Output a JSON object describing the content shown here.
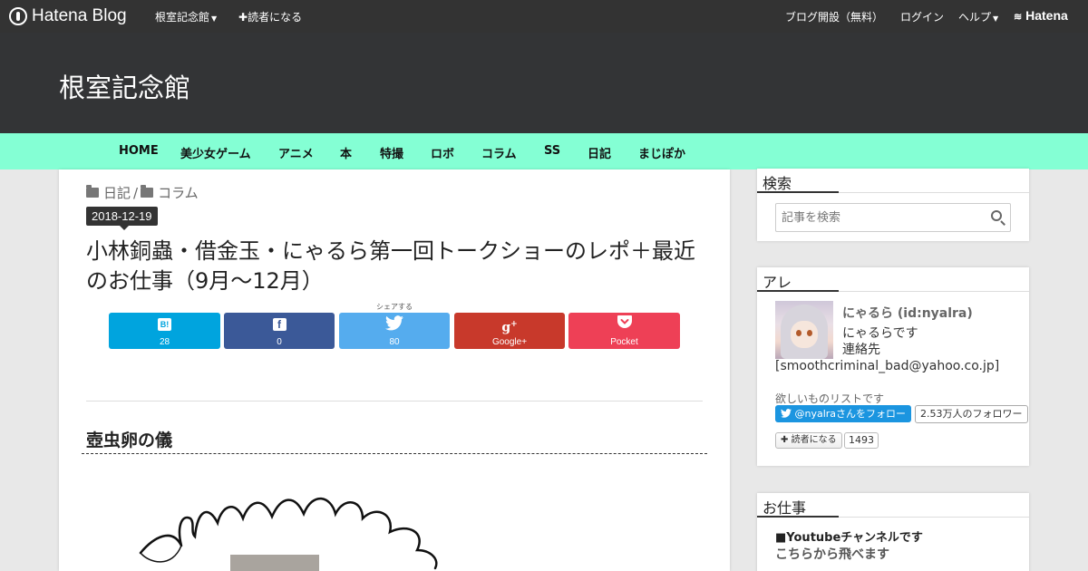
{
  "topbar": {
    "logo": "Hatena Blog",
    "blog_menu": "根室記念館",
    "subscribe": "読者になる",
    "open_blog": "ブログ開設（無料）",
    "login": "ログイン",
    "help": "ヘルプ",
    "hatena": "Hatena"
  },
  "header": {
    "blog_title": "根室記念館"
  },
  "gnav": [
    "HOME",
    "美少女ゲーム",
    "アニメ",
    "本",
    "特撮",
    "ロボ",
    "コラム",
    "SS",
    "日記",
    "まじぽか"
  ],
  "article": {
    "categories": [
      "日記",
      "コラム"
    ],
    "category_separator": "/",
    "date": "2018-12-19",
    "title": "小林銅蟲・借金玉・にゃるら第一回トークショーのレポ＋最近のお仕事（9月～12月）",
    "share_label": "シェアする",
    "share": [
      {
        "name": "hatena-bookmark",
        "icon": "B!",
        "count": "28",
        "color": "#00a4de"
      },
      {
        "name": "facebook",
        "icon": "f",
        "count": "0",
        "color": "#3b5998"
      },
      {
        "name": "twitter",
        "icon": "twitter-bird",
        "count": "80",
        "color": "#55acee"
      },
      {
        "name": "google-plus",
        "icon": "g+",
        "count": "Google+",
        "color": "#c8392b"
      },
      {
        "name": "pocket",
        "icon": "pocket",
        "count": "Pocket",
        "color": "#ee4056"
      }
    ],
    "section_heading": "壺虫卵の儀"
  },
  "sidebar": {
    "search": {
      "title": "検索",
      "placeholder": "記事を検索"
    },
    "profile": {
      "title": "アレ",
      "name": "にゃるら (id:nyalra)",
      "desc_line1": "にゃるらです",
      "desc_line2": "連絡先",
      "desc_line3": "[smoothcriminal_bad@yahoo.co.jp]",
      "wishlist": "欲しいものリストです",
      "twitter_follow": "@nyalraさんをフォロー",
      "twitter_followers": "2.53万人のフォロワー",
      "subscribe": "読者になる",
      "subscribers": "1493"
    },
    "work": {
      "title": "お仕事",
      "line1": "■Youtubeチャンネルです",
      "line2": "こちらから飛べます"
    }
  },
  "colors": {
    "topbar": "#333333",
    "header": "#333436",
    "gnav": "#84ffd4",
    "twitter": "#1b95e0"
  }
}
